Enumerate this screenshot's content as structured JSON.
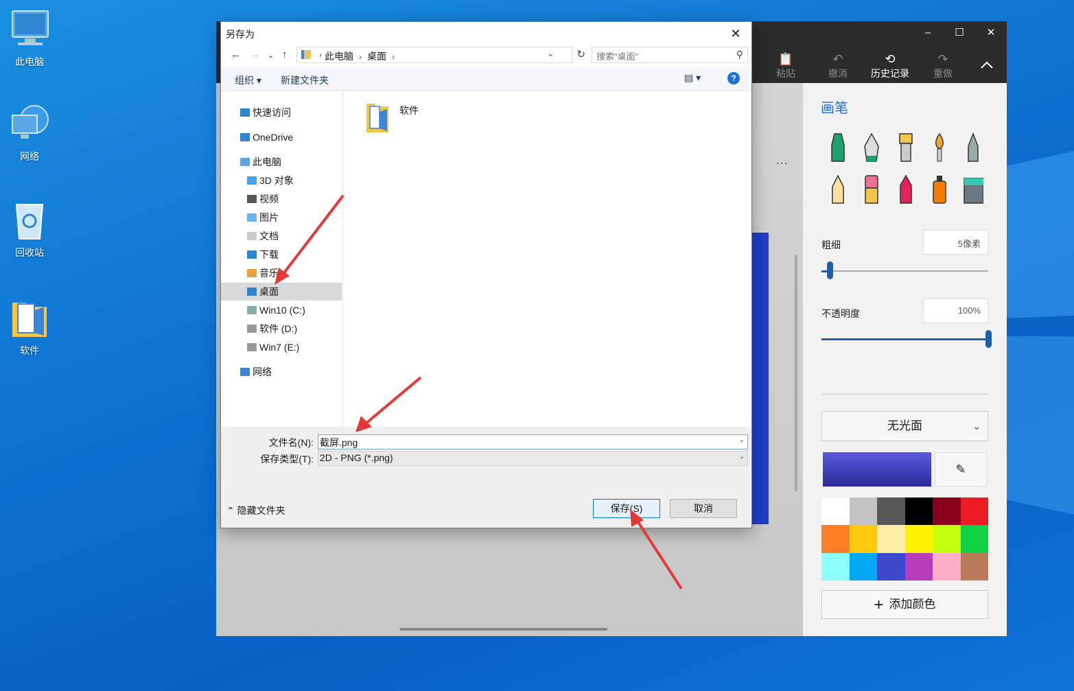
{
  "desktop": {
    "icons": [
      {
        "label": "此电脑",
        "icon": "computer-icon"
      },
      {
        "label": "网络",
        "icon": "network-globe-icon"
      },
      {
        "label": "回收站",
        "icon": "recycle-bin-icon"
      },
      {
        "label": "软件",
        "icon": "folder-icon"
      }
    ]
  },
  "paint": {
    "window_controls": {
      "minimize": "–",
      "maximize": "☐",
      "close": "✕"
    },
    "toolbar": [
      {
        "label": "粘贴",
        "icon": "paste-icon",
        "active": false
      },
      {
        "label": "撤消",
        "icon": "undo-icon",
        "active": false
      },
      {
        "label": "历史记录",
        "icon": "history-icon",
        "active": true
      },
      {
        "label": "重做",
        "icon": "redo-icon",
        "active": false
      }
    ],
    "collapse_icon": "chevron-up-icon",
    "more_label": "···",
    "panel": {
      "title": "画笔",
      "thickness_label": "粗细",
      "thickness_value": "5像素",
      "thickness_level": 0.05,
      "opacity_label": "不透明度",
      "opacity_value": "100%",
      "opacity_level": 1.0,
      "finish_label": "无光面",
      "add_color_label": "添加颜色",
      "palette": [
        "#ffffff",
        "#c3c3c3",
        "#585858",
        "#000000",
        "#88001b",
        "#ec1c24",
        "#ff7f27",
        "#ffc90e",
        "#fdeca6",
        "#fff200",
        "#c4ff0e",
        "#0ed145",
        "#8cfffb",
        "#00a8f3",
        "#3f48cc",
        "#b83dba",
        "#ffaec8",
        "#b97a57"
      ]
    }
  },
  "dialog": {
    "title": "另存为",
    "close": "✕",
    "nav": {
      "back": "←",
      "forward": "→",
      "recent": "⌄",
      "up": "↑"
    },
    "breadcrumb": [
      "此电脑",
      "桌面"
    ],
    "search_placeholder": "搜索\"桌面\"",
    "commands": {
      "organize": "组织 ▾",
      "new_folder": "新建文件夹",
      "help": "?"
    },
    "tree": [
      {
        "label": "快速访问",
        "indent": 1,
        "icon": "star-icon",
        "selected": false
      },
      {
        "label": "OneDrive",
        "indent": 1,
        "icon": "cloud-icon",
        "selected": false
      },
      {
        "label": "此电脑",
        "indent": 1,
        "icon": "computer-icon",
        "selected": false
      },
      {
        "label": "3D 对象",
        "indent": 2,
        "icon": "3d-objects-icon",
        "selected": false
      },
      {
        "label": "视频",
        "indent": 2,
        "icon": "video-icon",
        "selected": false
      },
      {
        "label": "图片",
        "indent": 2,
        "icon": "pictures-icon",
        "selected": false
      },
      {
        "label": "文档",
        "indent": 2,
        "icon": "documents-icon",
        "selected": false
      },
      {
        "label": "下载",
        "indent": 2,
        "icon": "downloads-icon",
        "selected": false
      },
      {
        "label": "音乐",
        "indent": 2,
        "icon": "music-icon",
        "selected": false
      },
      {
        "label": "桌面",
        "indent": 2,
        "icon": "desktop-icon",
        "selected": true
      },
      {
        "label": "Win10 (C:)",
        "indent": 2,
        "icon": "drive-c-icon",
        "selected": false
      },
      {
        "label": "软件 (D:)",
        "indent": 2,
        "icon": "drive-icon",
        "selected": false
      },
      {
        "label": "Win7 (E:)",
        "indent": 2,
        "icon": "drive-icon",
        "selected": false
      },
      {
        "label": "网络",
        "indent": 1,
        "icon": "network-icon",
        "selected": false
      }
    ],
    "files": [
      {
        "name": "软件",
        "icon": "folder-icon"
      }
    ],
    "filename_label": "文件名(N):",
    "filename_value": "截屏.png",
    "filetype_label": "保存类型(T):",
    "filetype_value": "2D - PNG (*.png)",
    "hide_folders": "隐藏文件夹",
    "save_label": "保存(S)",
    "cancel_label": "取消"
  },
  "colors": {
    "accent": "#1a6fd8",
    "annotation_arrow": "#e53935"
  }
}
